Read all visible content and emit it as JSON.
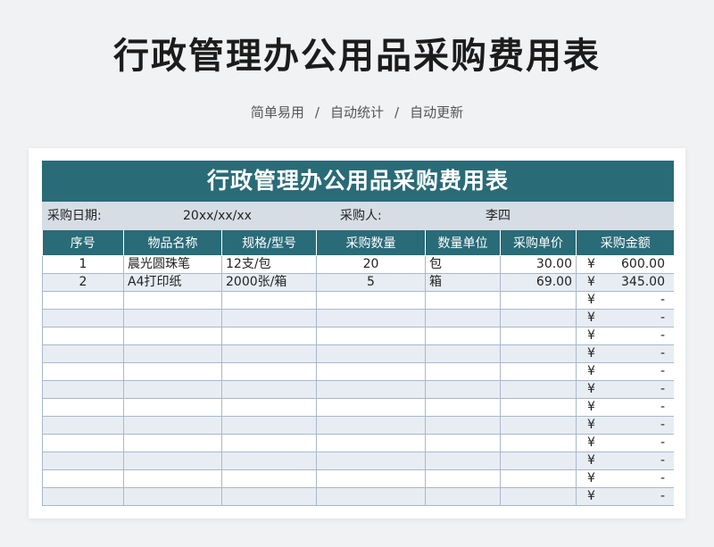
{
  "header": {
    "title": "行政管理办公用品采购费用表",
    "tagline": [
      "简单易用",
      "自动统计",
      "自动更新"
    ],
    "separator": "/"
  },
  "sheet": {
    "banner": "行政管理办公用品采购费用表",
    "date_label": "采购日期:",
    "date_value": "20xx/xx/xx",
    "buyer_label": "采购人:",
    "buyer_value": "李四",
    "columns": [
      "序号",
      "物品名称",
      "规格/型号",
      "采购数量",
      "数量单位",
      "采购单价",
      "采购金额"
    ],
    "currency": "¥",
    "empty_amount": "-",
    "rows": [
      {
        "no": "1",
        "name": "晨光圆珠笔",
        "spec": "12支/包",
        "qty": "20",
        "unit": "包",
        "price": "30.00",
        "amount": "600.00"
      },
      {
        "no": "2",
        "name": "A4打印纸",
        "spec": "2000张/箱",
        "qty": "5",
        "unit": "箱",
        "price": "69.00",
        "amount": "345.00"
      }
    ],
    "empty_row_count": 12
  },
  "colors": {
    "header_teal": "#2a6b78",
    "info_band": "#d6dde5",
    "stripe": "#e8edf4",
    "grid": "#a9b8cc"
  }
}
